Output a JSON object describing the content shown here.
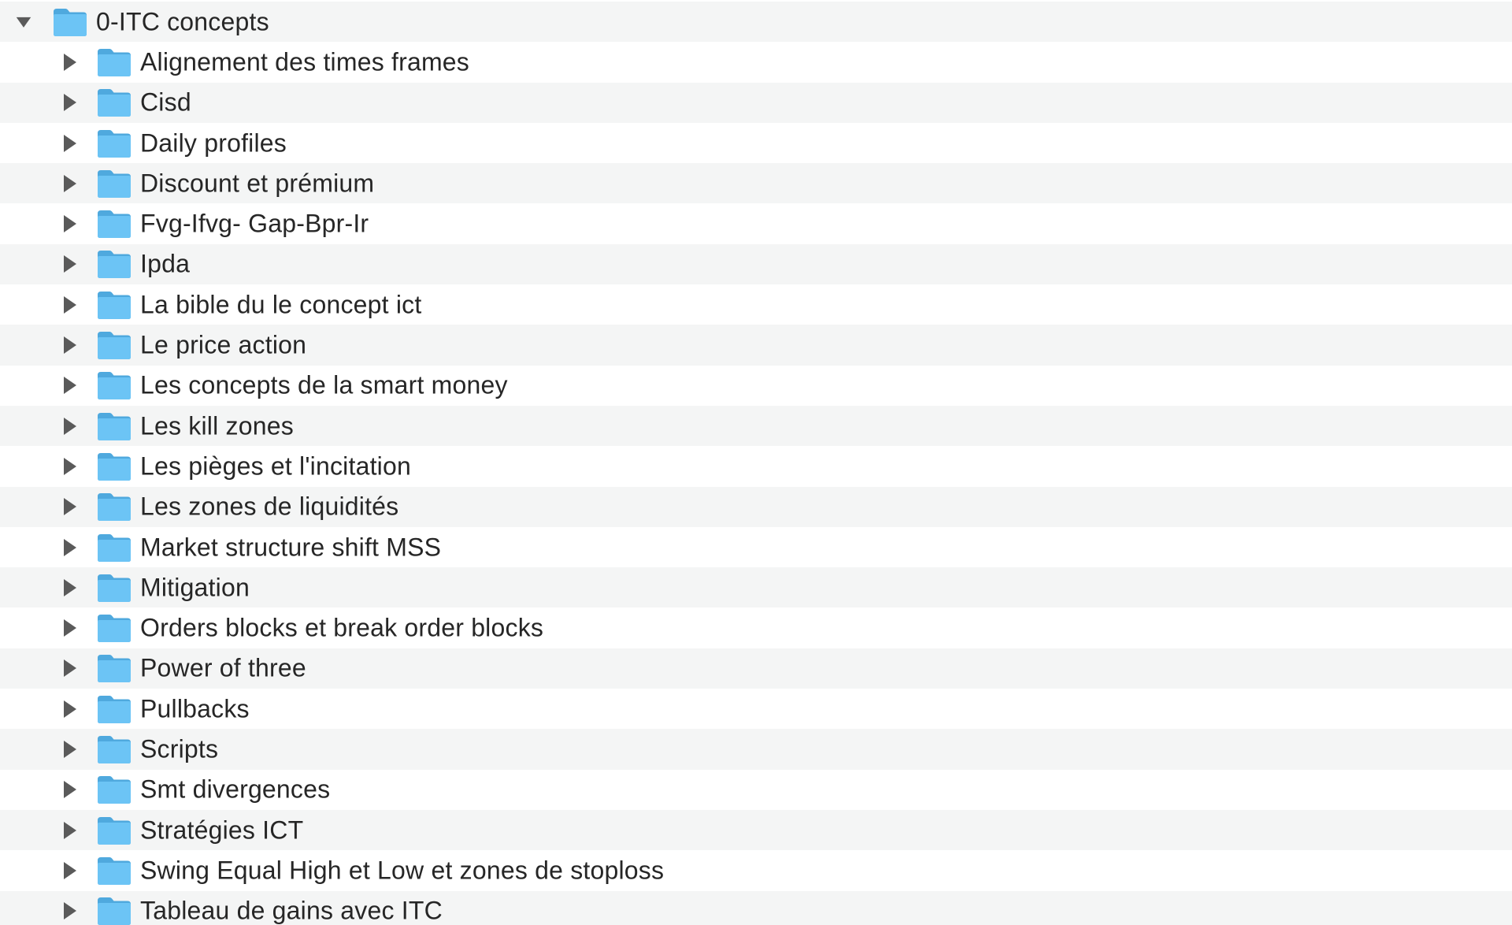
{
  "colors": {
    "folder_fill": "#6cc4f5",
    "folder_tab": "#4fa9de",
    "arrow": "#5a5a5a",
    "text": "#262626",
    "row_alt": "#f4f5f5"
  },
  "root": {
    "label": "0-ITC concepts",
    "expanded": true,
    "icon": "folder-icon"
  },
  "children": [
    {
      "label": "Alignement des times frames",
      "expanded": false
    },
    {
      "label": "Cisd",
      "expanded": false
    },
    {
      "label": "Daily profiles",
      "expanded": false
    },
    {
      "label": "Discount et prémium",
      "expanded": false
    },
    {
      "label": "Fvg-Ifvg- Gap-Bpr-Ir",
      "expanded": false
    },
    {
      "label": "Ipda",
      "expanded": false
    },
    {
      "label": "La bible du le concept ict",
      "expanded": false
    },
    {
      "label": "Le price action",
      "expanded": false
    },
    {
      "label": "Les concepts de la smart money",
      "expanded": false
    },
    {
      "label": "Les kill zones",
      "expanded": false
    },
    {
      "label": "Les pièges et l'incitation",
      "expanded": false
    },
    {
      "label": "Les zones de liquidités",
      "expanded": false
    },
    {
      "label": "Market structure shift MSS",
      "expanded": false
    },
    {
      "label": "Mitigation",
      "expanded": false
    },
    {
      "label": "Orders blocks et break order blocks",
      "expanded": false
    },
    {
      "label": "Power of three",
      "expanded": false
    },
    {
      "label": "Pullbacks",
      "expanded": false
    },
    {
      "label": "Scripts",
      "expanded": false
    },
    {
      "label": "Smt divergences",
      "expanded": false
    },
    {
      "label": "Stratégies ICT",
      "expanded": false
    },
    {
      "label": "Swing Equal High et Low et zones de stoploss",
      "expanded": false
    },
    {
      "label": "Tableau de gains avec ITC",
      "expanded": false
    }
  ]
}
